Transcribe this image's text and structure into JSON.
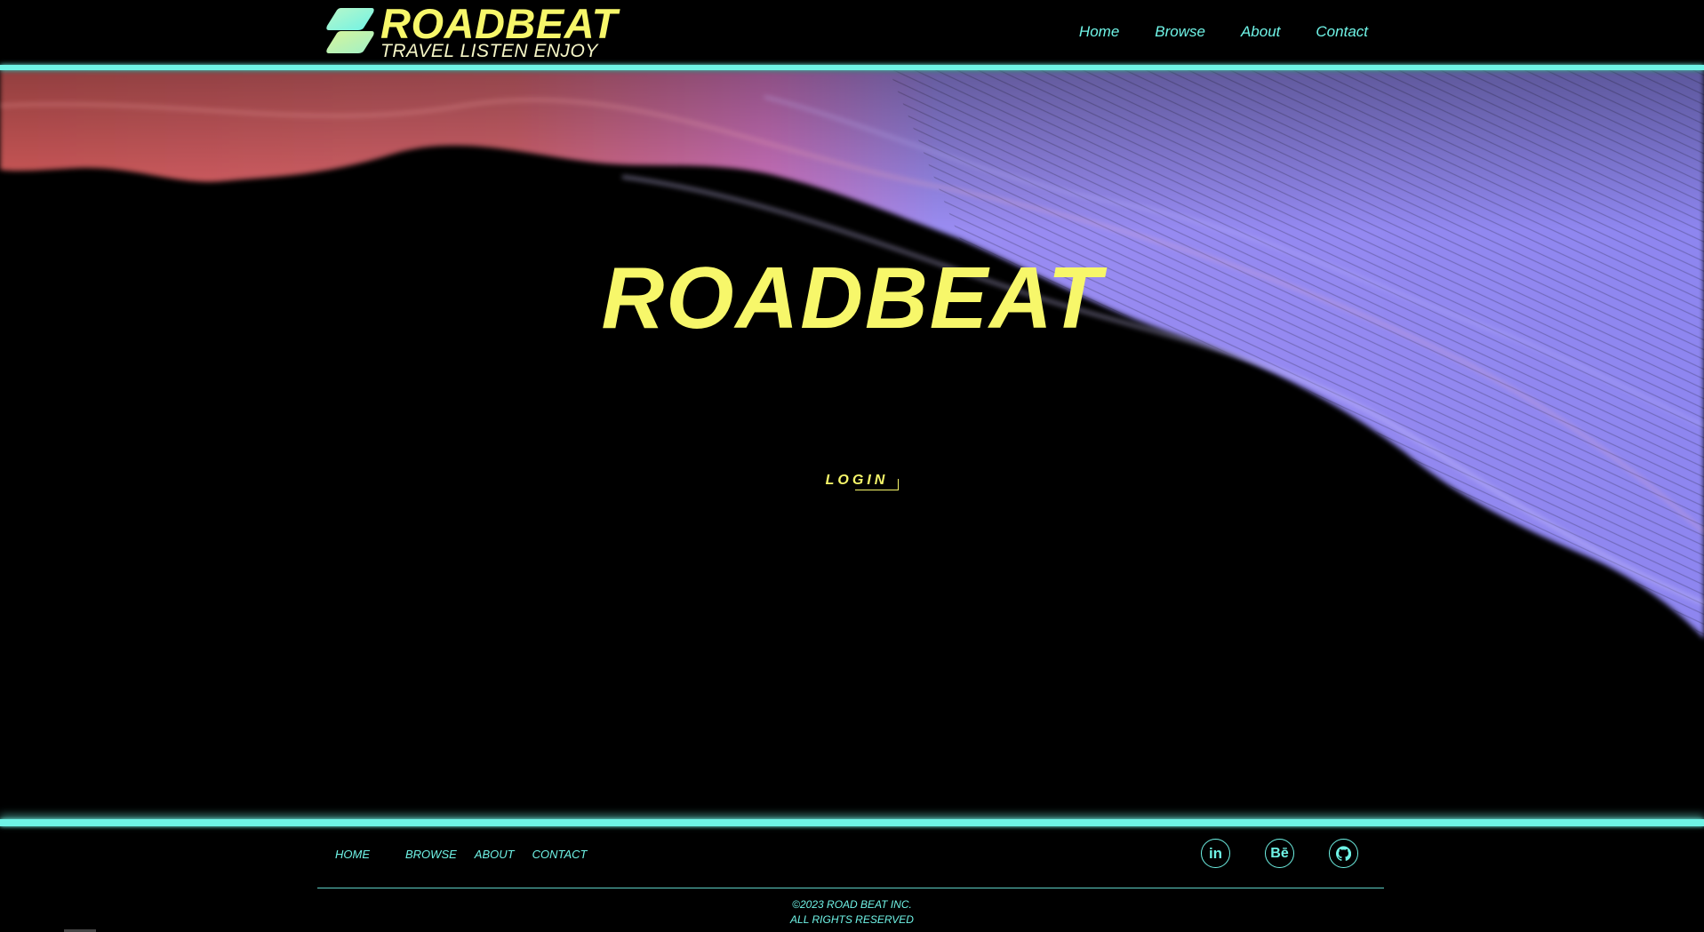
{
  "header": {
    "brand_title": "ROADBEAT",
    "brand_tagline": "TRAVEL LISTEN ENJOY",
    "nav": [
      {
        "label": "Home"
      },
      {
        "label": "Browse"
      },
      {
        "label": "About"
      },
      {
        "label": "Contact"
      }
    ]
  },
  "hero": {
    "title": "ROADBEAT",
    "login_label": "LOGIN"
  },
  "footer": {
    "nav": [
      {
        "label": "HOME"
      },
      {
        "label": "BROWSE"
      },
      {
        "label": "ABOUT"
      },
      {
        "label": "CONTACT"
      }
    ],
    "socials": [
      {
        "icon": "linkedin-icon",
        "glyph": "in"
      },
      {
        "icon": "behance-icon",
        "glyph": "Bē"
      },
      {
        "icon": "github-icon",
        "glyph": ""
      }
    ],
    "copyright_line1": "©2023 ROAD BEAT INC.",
    "copyright_line2": "ALL RIGHTS RESERVED"
  },
  "colors": {
    "accent_yellow": "#f7f76a",
    "accent_cyan": "#6ff3e6",
    "wave_red": "#e96b6b",
    "wave_violet": "#8e86f0",
    "background": "#000000"
  }
}
